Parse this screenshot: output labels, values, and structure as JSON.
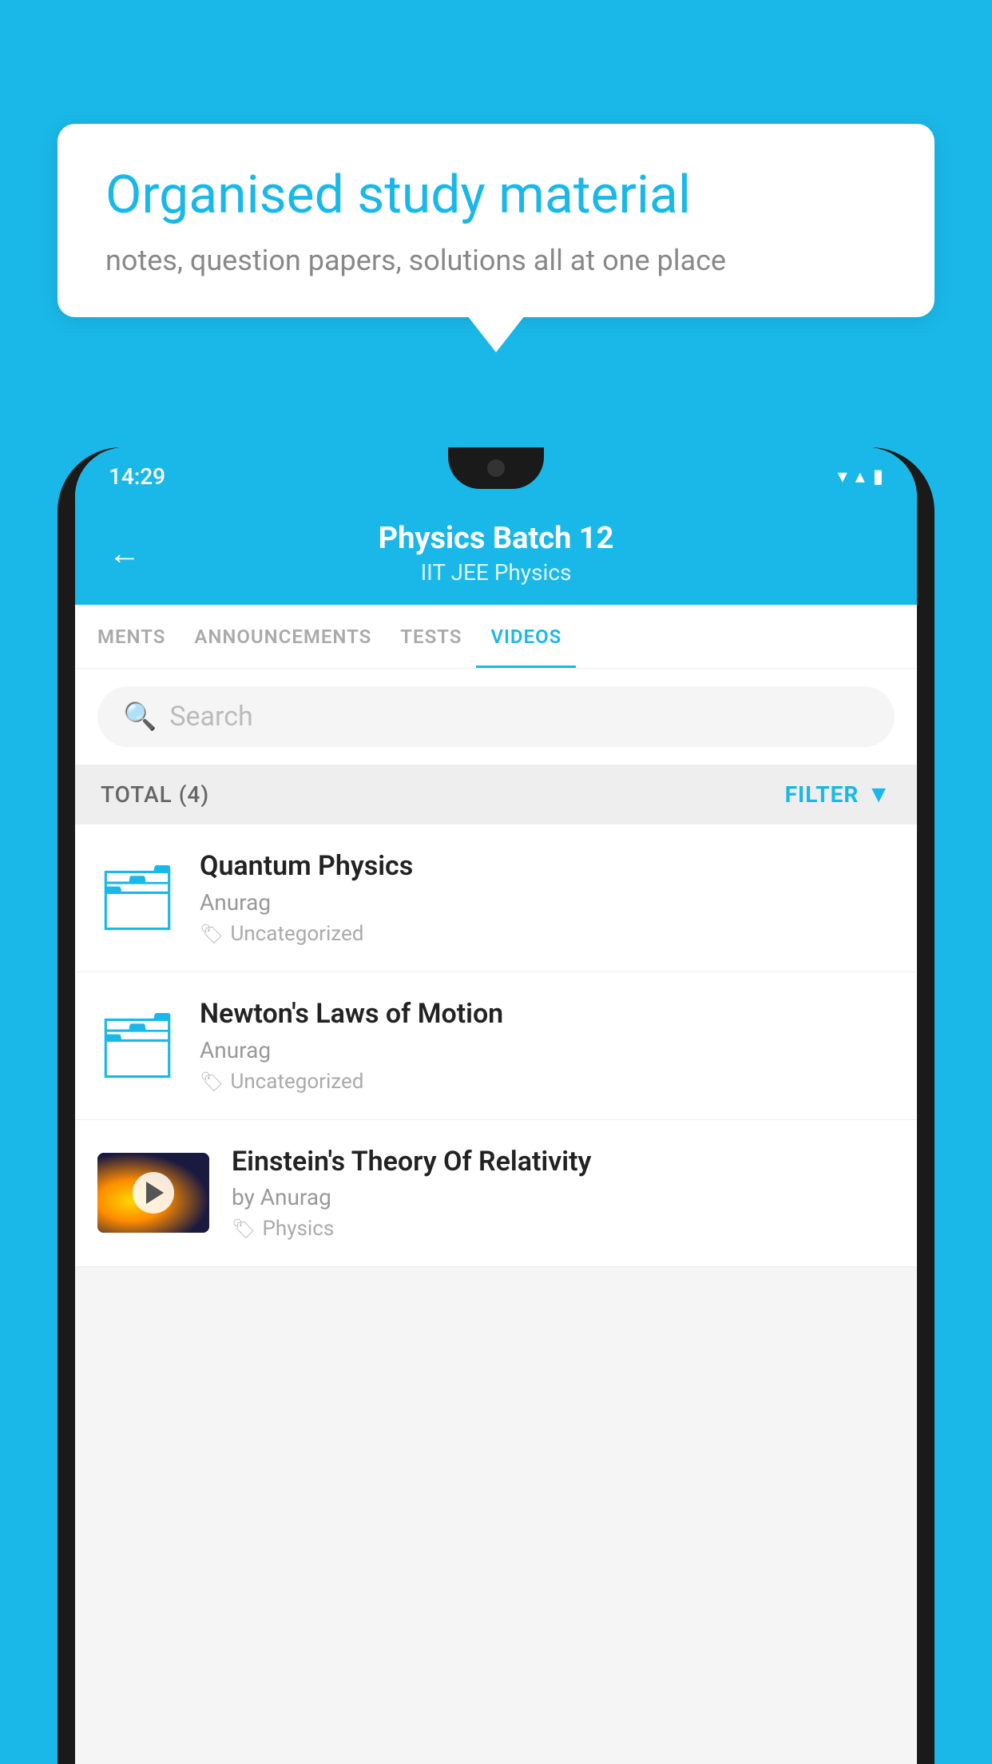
{
  "background_color": "#1ab8e8",
  "bubble": {
    "title": "Organised study material",
    "subtitle": "notes, question papers, solutions all at one place"
  },
  "phone": {
    "status_bar": {
      "time": "14:29",
      "icons": "▾◂▮"
    },
    "header": {
      "back_label": "←",
      "batch_name": "Physics Batch 12",
      "tags": "IIT JEE   Physics"
    },
    "tabs": [
      {
        "label": "MENTS",
        "active": false
      },
      {
        "label": "ANNOUNCEMENTS",
        "active": false
      },
      {
        "label": "TESTS",
        "active": false
      },
      {
        "label": "VIDEOS",
        "active": true
      }
    ],
    "search": {
      "placeholder": "Search"
    },
    "filter_bar": {
      "total_label": "TOTAL (4)",
      "filter_label": "FILTER"
    },
    "videos": [
      {
        "id": 1,
        "title": "Quantum Physics",
        "author": "Anurag",
        "tag": "Uncategorized",
        "has_thumb": false
      },
      {
        "id": 2,
        "title": "Newton's Laws of Motion",
        "author": "Anurag",
        "tag": "Uncategorized",
        "has_thumb": false
      },
      {
        "id": 3,
        "title": "Einstein's Theory Of Relativity",
        "author": "by Anurag",
        "tag": "Physics",
        "has_thumb": true
      }
    ]
  }
}
